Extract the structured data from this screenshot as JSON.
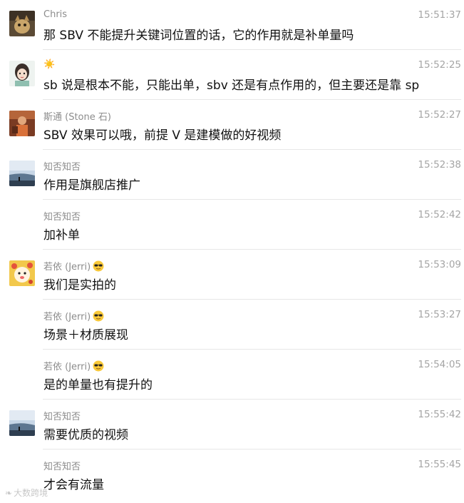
{
  "messages": [
    {
      "sender": "Chris",
      "time": "15:51:37",
      "text": "那 SBV 不能提升关键词位置的话，它的作用就是补单量吗",
      "avatar": "cat-avatar"
    },
    {
      "sender": "☀️",
      "time": "15:52:25",
      "text": "sb 说是根本不能，只能出单，sbv 还是有点作用的，但主要还是靠 sp",
      "avatar": "girl-cartoon-avatar"
    },
    {
      "sender": "斯通 (Stone 石)",
      "time": "15:52:27",
      "text": "SBV 效果可以哦，前提 V 是建模做的好视频",
      "avatar": "person-avatar"
    },
    {
      "sender": "知否知否",
      "time": "15:52:38",
      "text": "作用是旗舰店推广",
      "avatar": "seaside-avatar"
    },
    {
      "sender": "知否知否",
      "time": "15:52:42",
      "text": "加补单",
      "avatar": ""
    },
    {
      "sender": "若依 (Jerri)",
      "time": "15:53:09",
      "text": "我们是实拍的",
      "avatar": "cartoon-avatar",
      "emoji": "sunglasses-emoji"
    },
    {
      "sender": "若依 (Jerri)",
      "time": "15:53:27",
      "text": "场景＋材质展现",
      "avatar": "",
      "emoji": "sunglasses-emoji"
    },
    {
      "sender": "若依 (Jerri)",
      "time": "15:54:05",
      "text": "是的单量也有提升的",
      "avatar": "",
      "emoji": "sunglasses-emoji"
    },
    {
      "sender": "知否知否",
      "time": "15:55:42",
      "text": "需要优质的视频",
      "avatar": "seaside-avatar"
    },
    {
      "sender": "知否知否",
      "time": "15:55:45",
      "text": "才会有流量",
      "avatar": ""
    }
  ],
  "watermark": {
    "text": "大数跨境"
  }
}
